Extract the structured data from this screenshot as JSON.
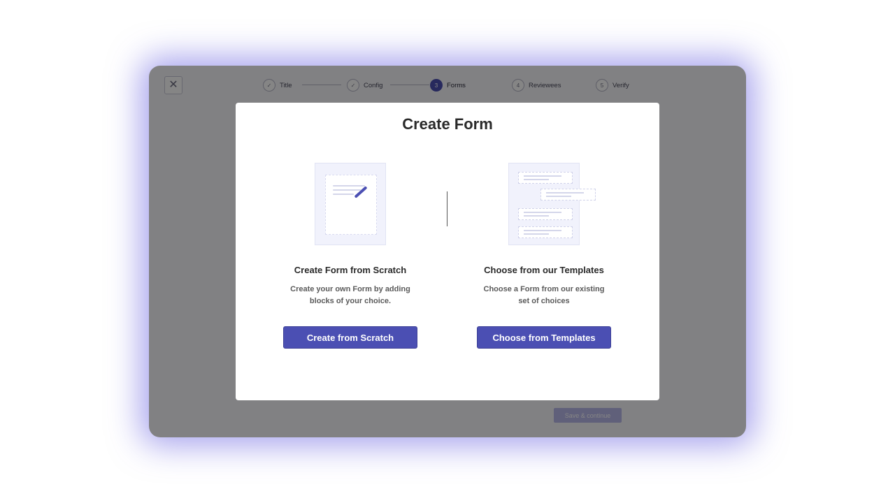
{
  "window": {
    "close_icon": "close-icon",
    "save_button_label": "Save & continue"
  },
  "stepper": {
    "steps": [
      {
        "label": "Title",
        "status": "done",
        "marker": "✓"
      },
      {
        "label": "Config",
        "status": "done",
        "marker": "✓"
      },
      {
        "label": "Forms",
        "status": "active",
        "marker": "3"
      },
      {
        "label": "Reviewees",
        "status": "pending",
        "marker": "4"
      },
      {
        "label": "Verify",
        "status": "pending",
        "marker": "5"
      }
    ]
  },
  "modal": {
    "title": "Create Form",
    "options": [
      {
        "title": "Create Form from Scratch",
        "desc_line1": "Create your own Form by adding",
        "desc_line2": "blocks of your choice.",
        "button_label": "Create from Scratch",
        "illustration_icon": "blank-form-pen-icon"
      },
      {
        "title": "Choose from our Templates",
        "desc_line1": "Choose a Form from our existing",
        "desc_line2": "set of choices",
        "button_label": "Choose from Templates",
        "illustration_icon": "form-templates-icon"
      }
    ]
  },
  "colors": {
    "accent": "#4b4fb3",
    "glow": "#605ade",
    "overlay": "rgba(0,0,0,0.48)"
  }
}
